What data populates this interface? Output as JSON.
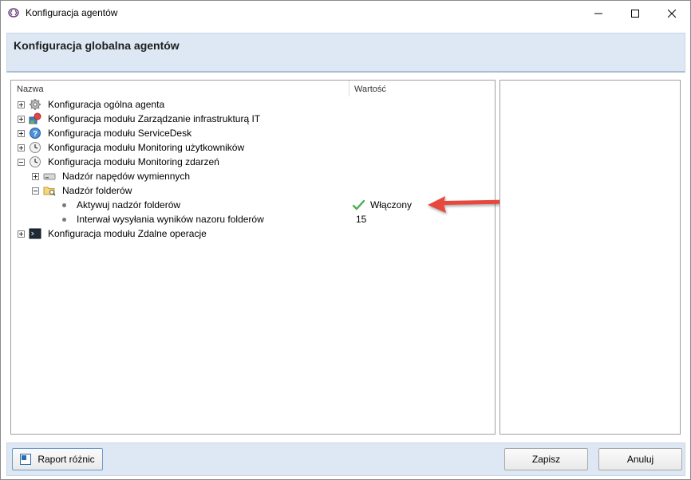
{
  "window": {
    "title": "Konfiguracja agentów",
    "controls": [
      "minimize",
      "maximize",
      "close"
    ]
  },
  "header": {
    "title": "Konfiguracja globalna agentów"
  },
  "tree": {
    "columns": {
      "name": "Nazwa",
      "value": "Wartość"
    },
    "rows": [
      {
        "label": "Konfiguracja ogólna agenta",
        "icon": "gear-icon",
        "expanded": false
      },
      {
        "label": "Konfiguracja modułu Zarządzanie infrastrukturą IT",
        "icon": "infrastructure-icon",
        "expanded": false
      },
      {
        "label": "Konfiguracja modułu ServiceDesk",
        "icon": "help-icon",
        "expanded": false
      },
      {
        "label": "Konfiguracja modułu Monitoring użytkowników",
        "icon": "clock-icon",
        "expanded": false
      },
      {
        "label": "Konfiguracja modułu Monitoring zdarzeń",
        "icon": "clock-icon",
        "expanded": true
      },
      {
        "label": "Nadzór napędów wymiennych",
        "icon": "drive-icon",
        "expanded": false
      },
      {
        "label": "Nadzór folderów",
        "icon": "folder-search-icon",
        "expanded": true
      },
      {
        "label": "Aktywuj nadzór folderów",
        "value": "Włączony",
        "value_icon": "check-icon"
      },
      {
        "label": "Interwał wysyłania wyników nazoru folderów",
        "value": "15"
      },
      {
        "label": "Konfiguracja modułu Zdalne operacje",
        "icon": "terminal-icon",
        "expanded": false
      }
    ]
  },
  "annotation": {
    "type": "arrow",
    "color": "#e8473c",
    "points_to": "Włączony"
  },
  "buttons": {
    "report": "Raport różnic",
    "save": "Zapisz",
    "cancel": "Anuluj"
  },
  "colors": {
    "header_band": "#dde8f4",
    "check": "#4caf50",
    "arrow": "#e8473c"
  }
}
